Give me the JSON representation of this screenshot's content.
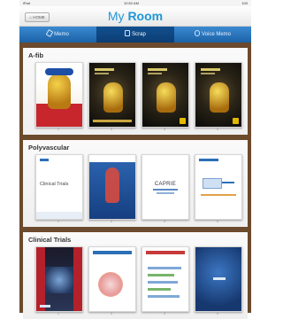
{
  "status_bar": {
    "carrier": "iPad",
    "time": "10:52 AM",
    "battery": "100"
  },
  "nav": {
    "home_label": "HOME",
    "title_prefix": "My ",
    "title_bold": "Room"
  },
  "tabs": [
    {
      "label": "Memo",
      "icon": "pencil-icon",
      "active": false
    },
    {
      "label": "Scrap",
      "icon": "clip-icon",
      "active": true
    },
    {
      "label": "Voice Memo",
      "icon": "microphone-icon",
      "active": false
    }
  ],
  "sections": [
    {
      "title": "A-fib",
      "items": [
        {
          "num": "1"
        },
        {
          "num": "2"
        },
        {
          "num": "3"
        },
        {
          "num": "4"
        }
      ]
    },
    {
      "title": "Polyvascular",
      "items": [
        {
          "num": "1",
          "cover_text": "Clinical Trials"
        },
        {
          "num": "2"
        },
        {
          "num": "3",
          "cover_text": "CAPRIE"
        },
        {
          "num": "4"
        }
      ]
    },
    {
      "title": "Clinical Trials",
      "items": [
        {
          "num": "1"
        },
        {
          "num": "2"
        },
        {
          "num": "3"
        },
        {
          "num": "4"
        }
      ]
    }
  ],
  "colors": {
    "accent": "#1f97d8",
    "tab_bar": "#1c62a8",
    "shelf": "#6b4a2d",
    "afib_red": "#c7262c"
  }
}
